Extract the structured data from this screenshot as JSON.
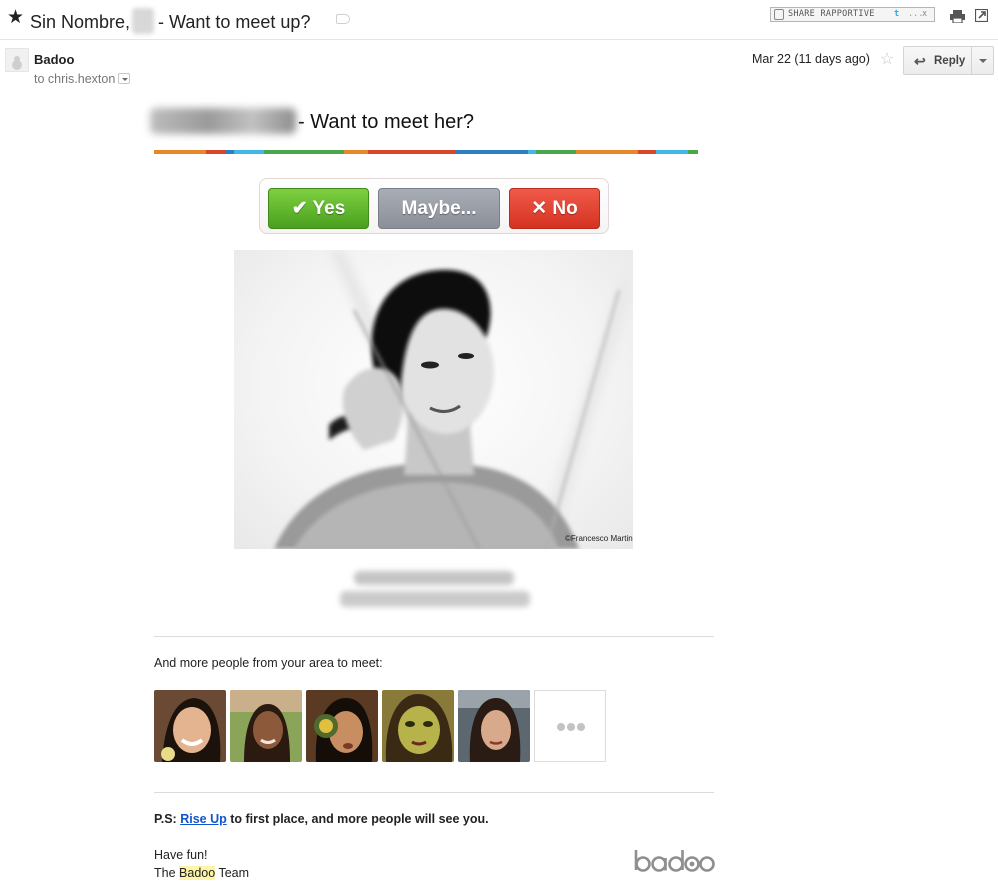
{
  "subject": {
    "prefix": "Sin Nombre,",
    "suffix": "- Want to meet up?"
  },
  "toolbar": {
    "rapportive_label": "SHARE RAPPORTIVE",
    "rapportive_dots": "...",
    "rapportive_close": "x"
  },
  "header": {
    "sender": "Badoo",
    "recipient": "to chris.hexton",
    "date": "Mar 22 (11 days ago)",
    "reply_label": "Reply"
  },
  "body": {
    "headline_suffix": "- Want to meet her?",
    "stripe_colors": [
      "#e8862a",
      "#d9472a",
      "#2e7fc1",
      "#42b6e6",
      "#4aa84a",
      "#e8862a",
      "#d9472a",
      "#2e7fc1",
      "#42b6e6",
      "#4aa84a",
      "#e8862a",
      "#d9472a",
      "#42b6e6",
      "#4aa84a"
    ],
    "buttons": {
      "yes": "✔ Yes",
      "maybe": "Maybe...",
      "no": "✕ No"
    },
    "photo_credit": "©Francesco Martini fotografia",
    "more_people": "And more people from your area to meet:",
    "ps_prefix": "P.S:",
    "ps_link": "Rise Up",
    "ps_suffix": "to first place, and more people will see you.",
    "have_fun": "Have fun!",
    "team_prefix": "The",
    "team_highlight": "Badoo",
    "team_suffix": "Team",
    "logo_text": "badoo"
  },
  "colors": {
    "yes_green": "#4aa01f",
    "maybe_gray": "#8a8f99",
    "no_red": "#d53322",
    "link_blue": "#1155cc"
  }
}
